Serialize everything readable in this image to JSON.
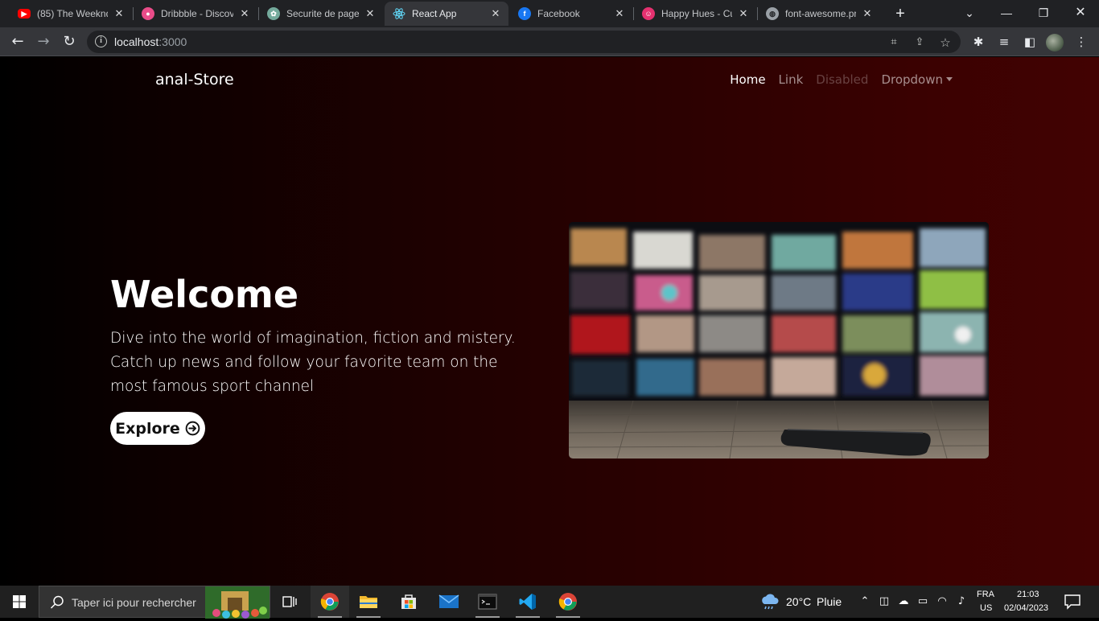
{
  "browser": {
    "tabs": [
      {
        "title": "(85) The Weeknd",
        "favicon": "youtube-icon",
        "color": "#ff0000",
        "active": false
      },
      {
        "title": "Dribbble - Discov",
        "favicon": "dribbble-icon",
        "color": "#ea4c89",
        "active": false
      },
      {
        "title": "Securite de page",
        "favicon": "chatgpt-icon",
        "color": "#74aa9c",
        "active": false
      },
      {
        "title": "React App",
        "favicon": "react-icon",
        "color": "#61dafb",
        "active": true
      },
      {
        "title": "Facebook",
        "favicon": "facebook-icon",
        "color": "#1877f2",
        "active": false
      },
      {
        "title": "Happy Hues - Cu",
        "favicon": "happyhues-icon",
        "color": "#e53170",
        "active": false
      },
      {
        "title": "font-awesome.pr",
        "favicon": "globe-icon",
        "color": "#9aa0a6",
        "active": false
      }
    ],
    "url_host": "localhost",
    "url_port": ":3000"
  },
  "site": {
    "brand": "anal-Store",
    "nav": [
      {
        "label": "Home",
        "state": "active"
      },
      {
        "label": "Link",
        "state": "normal"
      },
      {
        "label": "Disabled",
        "state": "disabled"
      },
      {
        "label": "Dropdown",
        "state": "dropdown"
      }
    ],
    "hero": {
      "title": "Welcome",
      "text": "Dive into the world of imagination, fiction and mistery. Catch up news and follow your favorite team on the most famous sport channel",
      "button": "Explore"
    }
  },
  "taskbar": {
    "search_placeholder": "Taper ici pour rechercher",
    "weather_temp": "20°C",
    "weather_desc": "Pluie",
    "lang_top": "FRA",
    "lang_bottom": "US",
    "time": "21:03",
    "date": "02/04/2023"
  },
  "colors": {
    "gradient_start": "#000000",
    "gradient_end": "#420202",
    "chrome_bg": "#202124",
    "taskbar_bg": "#202020"
  }
}
